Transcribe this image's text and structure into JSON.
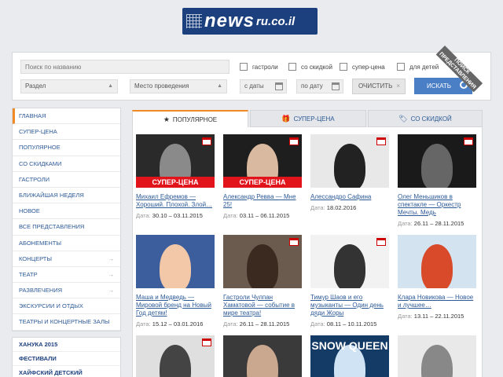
{
  "logo": {
    "main": "news",
    "suffix": "ru.co.il"
  },
  "search": {
    "name_placeholder": "Поиск по названию",
    "section": "Раздел",
    "venue": "Место проведения",
    "date_from": "с даты",
    "date_to": "по дату",
    "clear_label": "ОЧИСТИТЬ",
    "find_label": "ИСКАТЬ",
    "ribbon": "ПОИСК ПРЕДСТАВЛЕНИЯ",
    "filters": [
      "гастроли",
      "со скидкой",
      "супер-цена",
      "для детей"
    ]
  },
  "sidebar": {
    "items": [
      {
        "label": "ГЛАВНАЯ",
        "arrow": ""
      },
      {
        "label": "СУПЕР-ЦЕНА",
        "arrow": ""
      },
      {
        "label": "ПОПУЛЯРНОЕ",
        "arrow": ""
      },
      {
        "label": "СО СКИДКАМИ",
        "arrow": ""
      },
      {
        "label": "ГАСТРОЛИ",
        "arrow": ""
      },
      {
        "label": "БЛИЖАЙШАЯ НЕДЕЛЯ",
        "arrow": ""
      },
      {
        "label": "НОВОЕ",
        "arrow": ""
      },
      {
        "label": "ВСЕ ПРЕДСТАВЛЕНИЯ",
        "arrow": ""
      },
      {
        "label": "АБОНЕМЕНТЫ",
        "arrow": ""
      },
      {
        "label": "КОНЦЕРТЫ",
        "arrow": "→"
      },
      {
        "label": "ТЕАТР",
        "arrow": "→"
      },
      {
        "label": "РАЗВЛЕЧЕНИЯ",
        "arrow": "→"
      },
      {
        "label": "ЭКСКУРСИИ И ОТДЫХ",
        "arrow": ""
      },
      {
        "label": "ТЕАТРЫ И КОНЦЕРТНЫЕ ЗАЛЫ",
        "arrow": ""
      }
    ],
    "special": [
      "ХАНУКА 2015",
      "ФЕСТИВАЛИ",
      "ХАЙФСКИЙ ДЕТСКИЙ ФЕСТИВАЛЬ"
    ]
  },
  "tabs": [
    {
      "label": "ПОПУЛЯРНОЕ",
      "icon": "★"
    },
    {
      "label": "СУПЕР-ЦЕНА",
      "icon": "🎁"
    },
    {
      "label": "СО СКИДКОЙ",
      "icon": "🏷"
    }
  ],
  "date_label": "Дата:",
  "super_label": "СУПЕР-ЦЕНА",
  "cards": [
    {
      "title": "Михаил Ефремов — Хороший. Плохой. Злой…",
      "date": "30.10 – 03.11.2015",
      "super": true
    },
    {
      "title": "Александр Ревва — Мне 25!",
      "date": "03.11 – 06.11.2015",
      "super": true
    },
    {
      "title": "Алессандро Сафина",
      "date": "18.02.2016",
      "super": false
    },
    {
      "title": "Олег Меньшиков в спектакле — Оркестр Мечты. Медь",
      "date": "26.11 – 28.11.2015",
      "super": false
    },
    {
      "title": "Маша и Медведь — Мировой бренд на Новый Год детям!",
      "date": "15.12 – 03.01.2016",
      "super": false
    },
    {
      "title": "Гастроли Чулпан Хаматовой — событие в мире театра!",
      "date": "26.11 – 28.11.2015",
      "super": false
    },
    {
      "title": "Тимур Шаов и его музыканты — Один день дяди Жоры",
      "date": "08.11 – 10.11.2015",
      "super": false
    },
    {
      "title": "Клара Новикова — Новое и лучшее…",
      "date": "13.11 – 22.11.2015",
      "super": false
    },
    {
      "title": "",
      "date": "",
      "super": false
    },
    {
      "title": "",
      "date": "",
      "super": false
    },
    {
      "title": "",
      "date": "",
      "super": false
    },
    {
      "title": "",
      "date": "",
      "super": false
    }
  ],
  "snow_queen_text": "SNOW QUEEN"
}
